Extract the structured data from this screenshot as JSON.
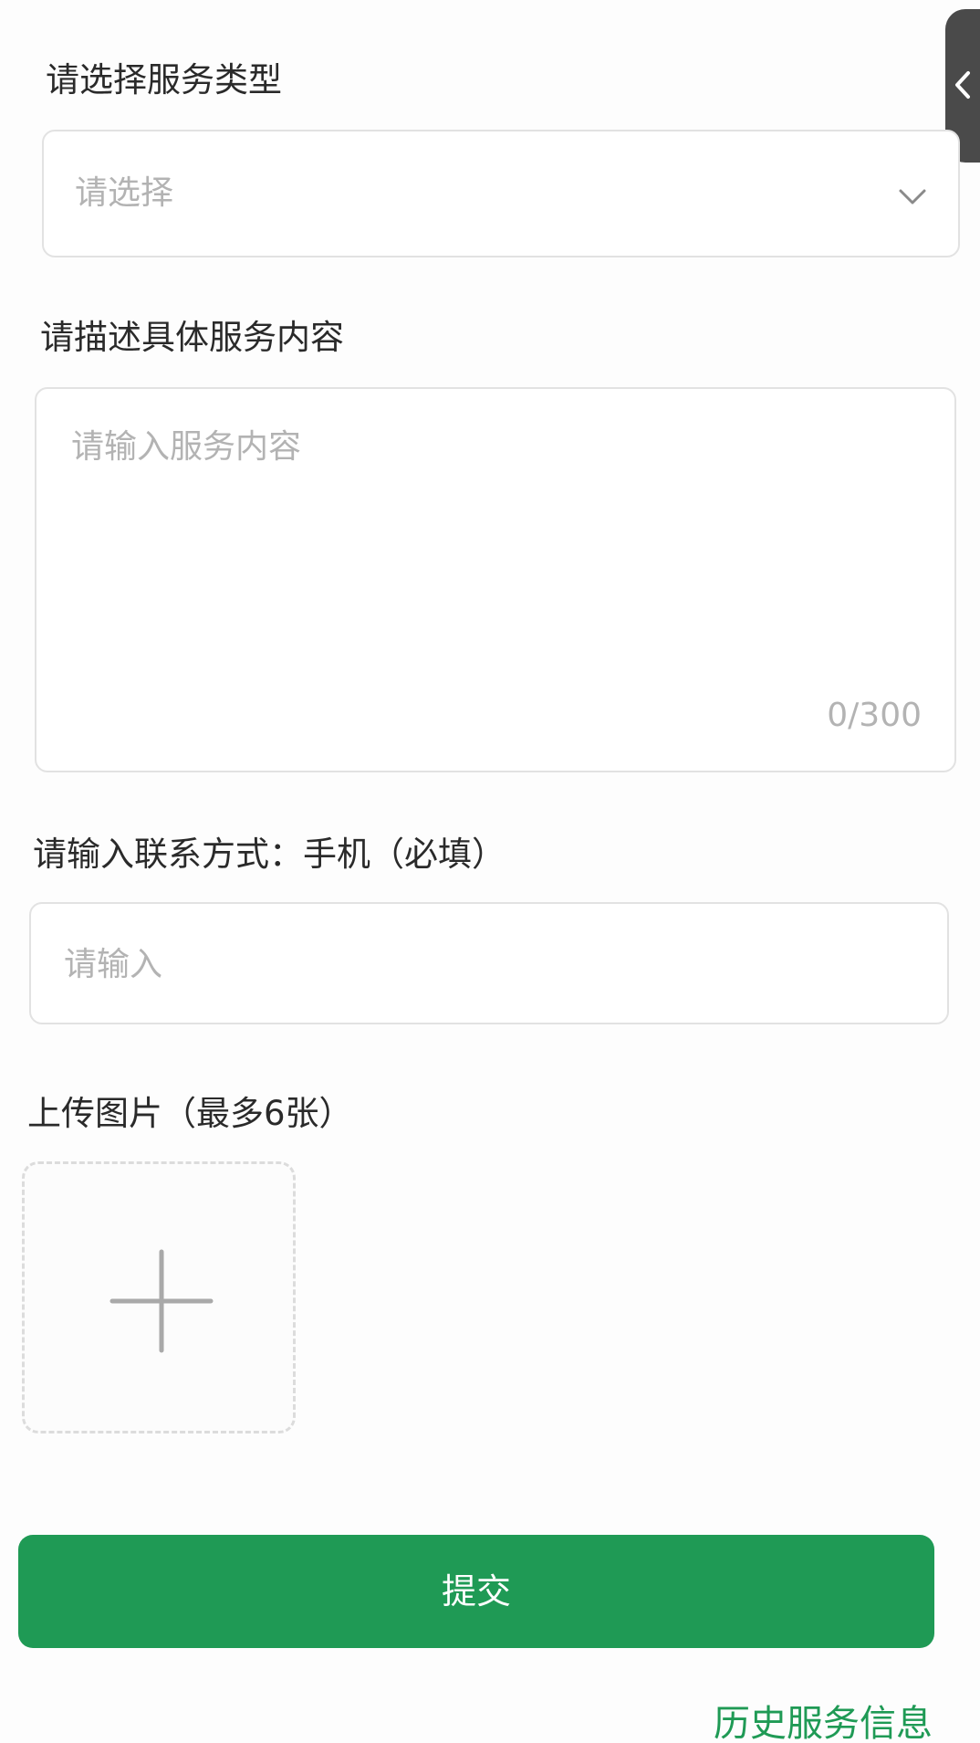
{
  "service_type": {
    "label": "请选择服务类型",
    "placeholder": "请选择",
    "icon": "chevron-down-icon"
  },
  "service_content": {
    "label": "请描述具体服务内容",
    "placeholder": "请输入服务内容",
    "counter": "0/300"
  },
  "contact": {
    "label": "请输入联系方式：手机（必填）",
    "placeholder": "请输入"
  },
  "upload": {
    "label": "上传图片（最多6张）",
    "icon": "plus-icon"
  },
  "submit_label": "提交",
  "history_link": "历史服务信息",
  "side_tab": {
    "icon": "chevron-left-icon"
  },
  "colors": {
    "primary": "#1f9a55",
    "placeholder": "#b3b3b3",
    "border": "#e2e2e2"
  }
}
